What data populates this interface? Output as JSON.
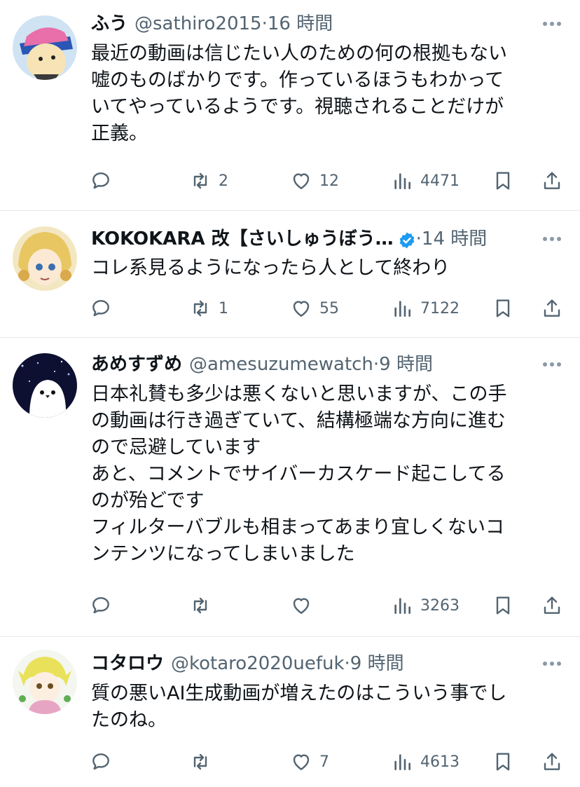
{
  "tweets": [
    {
      "name": "ふう",
      "handle": "@sathiro2015",
      "time": "·16 時間",
      "verified": false,
      "lines": [
        "最近の動画は信じたい人のための何の根拠もない",
        "嘘のものばかりです。作っているほうもわかって",
        "いてやっているようです。視聴されることだけが",
        "正義。"
      ],
      "reply_count": "",
      "retweet_count": "2",
      "like_count": "12",
      "view_count": "4471"
    },
    {
      "name": "KOKOKARA 改【さいしゅうぼう…",
      "handle": "",
      "time": "·14 時間",
      "verified": true,
      "lines": [
        "コレ系見るようになったら人として終わり"
      ],
      "reply_count": "",
      "retweet_count": "1",
      "like_count": "55",
      "view_count": "7122"
    },
    {
      "name": "あめすずめ",
      "handle": "@amesuzumewatch",
      "time": "·9 時間",
      "verified": false,
      "lines": [
        "日本礼賛も多少は悪くないと思いますが、この手",
        "の動画は行き過ぎていて、結構極端な方向に進む",
        "ので忌避しています",
        "あと、コメントでサイバーカスケード起こしてる",
        "のが殆どです",
        "フィルターバブルも相まってあまり宜しくないコ",
        "ンテンツになってしまいました"
      ],
      "reply_count": "",
      "retweet_count": "",
      "like_count": "",
      "view_count": "3263"
    },
    {
      "name": "コタロウ",
      "handle": "@kotaro2020uefuk",
      "time": "·9 時間",
      "verified": false,
      "lines": [
        "質の悪いAI生成動画が増えたのはこういう事でし",
        "たのね。"
      ],
      "reply_count": "",
      "retweet_count": "",
      "like_count": "7",
      "view_count": "4613"
    }
  ],
  "icons": {
    "reply": "reply-icon",
    "retweet": "retweet-icon",
    "like": "heart-icon",
    "views": "views-icon",
    "bookmark": "bookmark-icon",
    "share": "share-icon",
    "more": "more-icon",
    "verified": "verified-badge-icon"
  },
  "colors": {
    "text": "#0f1419",
    "secondary": "#536471",
    "verified": "#1d9bf0",
    "divider": "#e6e9ec"
  }
}
